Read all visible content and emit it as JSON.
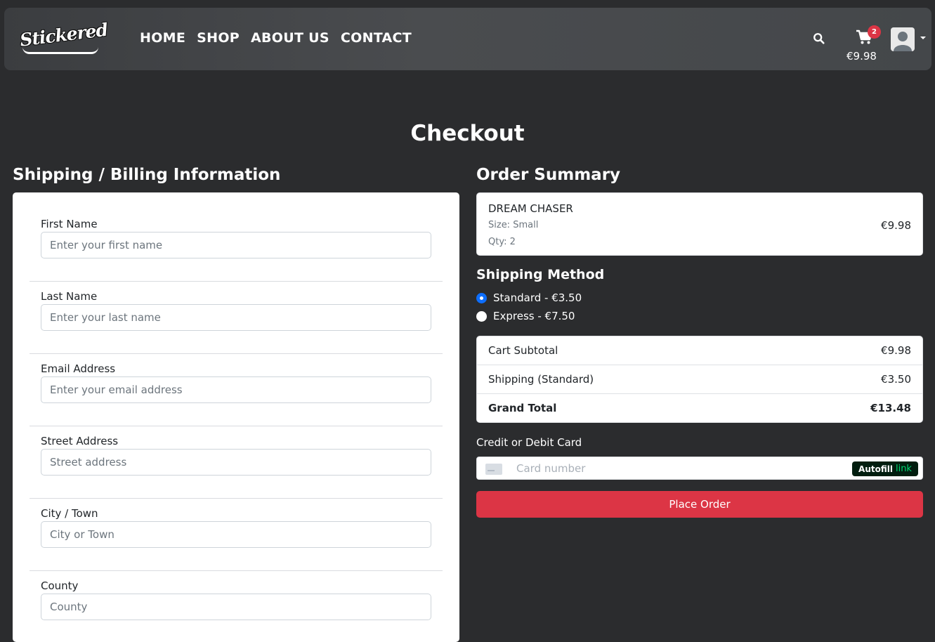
{
  "brand": {
    "logo_text": "Stickered"
  },
  "nav": {
    "links": [
      {
        "label": "HOME"
      },
      {
        "label": "SHOP"
      },
      {
        "label": "ABOUT US"
      },
      {
        "label": "CONTACT"
      }
    ]
  },
  "header": {
    "cart_count": "2",
    "cart_total": "€9.98",
    "search_icon": "search-icon",
    "cart_icon": "cart-icon",
    "user_icon": "user-avatar-icon"
  },
  "page": {
    "title": "Checkout",
    "shipping_billing_title": "Shipping / Billing Information",
    "order_summary_title": "Order Summary"
  },
  "form": {
    "fields": [
      {
        "label": "First Name",
        "placeholder": "Enter your first name"
      },
      {
        "label": "Last Name",
        "placeholder": "Enter your last name"
      },
      {
        "label": "Email Address",
        "placeholder": "Enter your email address"
      },
      {
        "label": "Street Address",
        "placeholder": "Street address"
      },
      {
        "label": "City / Town",
        "placeholder": "City or Town"
      },
      {
        "label": "County",
        "placeholder": "County"
      }
    ]
  },
  "order": {
    "item": {
      "name": "DREAM CHASER",
      "size": "Size: Small",
      "qty": "Qty: 2",
      "price": "€9.98"
    },
    "shipping_method_title": "Shipping Method",
    "shipping_options": [
      {
        "label": "Standard - €3.50",
        "selected": true
      },
      {
        "label": "Express - €7.50",
        "selected": false
      }
    ],
    "totals": [
      {
        "label": "Cart Subtotal",
        "value": "€9.98"
      },
      {
        "label": "Shipping (Standard)",
        "value": "€3.50"
      },
      {
        "label": "Grand Total",
        "value": "€13.48"
      }
    ],
    "card": {
      "label": "Credit or Debit Card",
      "placeholder": "Card number",
      "autofill_text": "Autofill",
      "autofill_link": "link"
    },
    "place_order_label": "Place Order"
  },
  "colors": {
    "background": "#2b2c2e",
    "accent": "#dc3545",
    "radio_selected": "#0d6efd"
  }
}
